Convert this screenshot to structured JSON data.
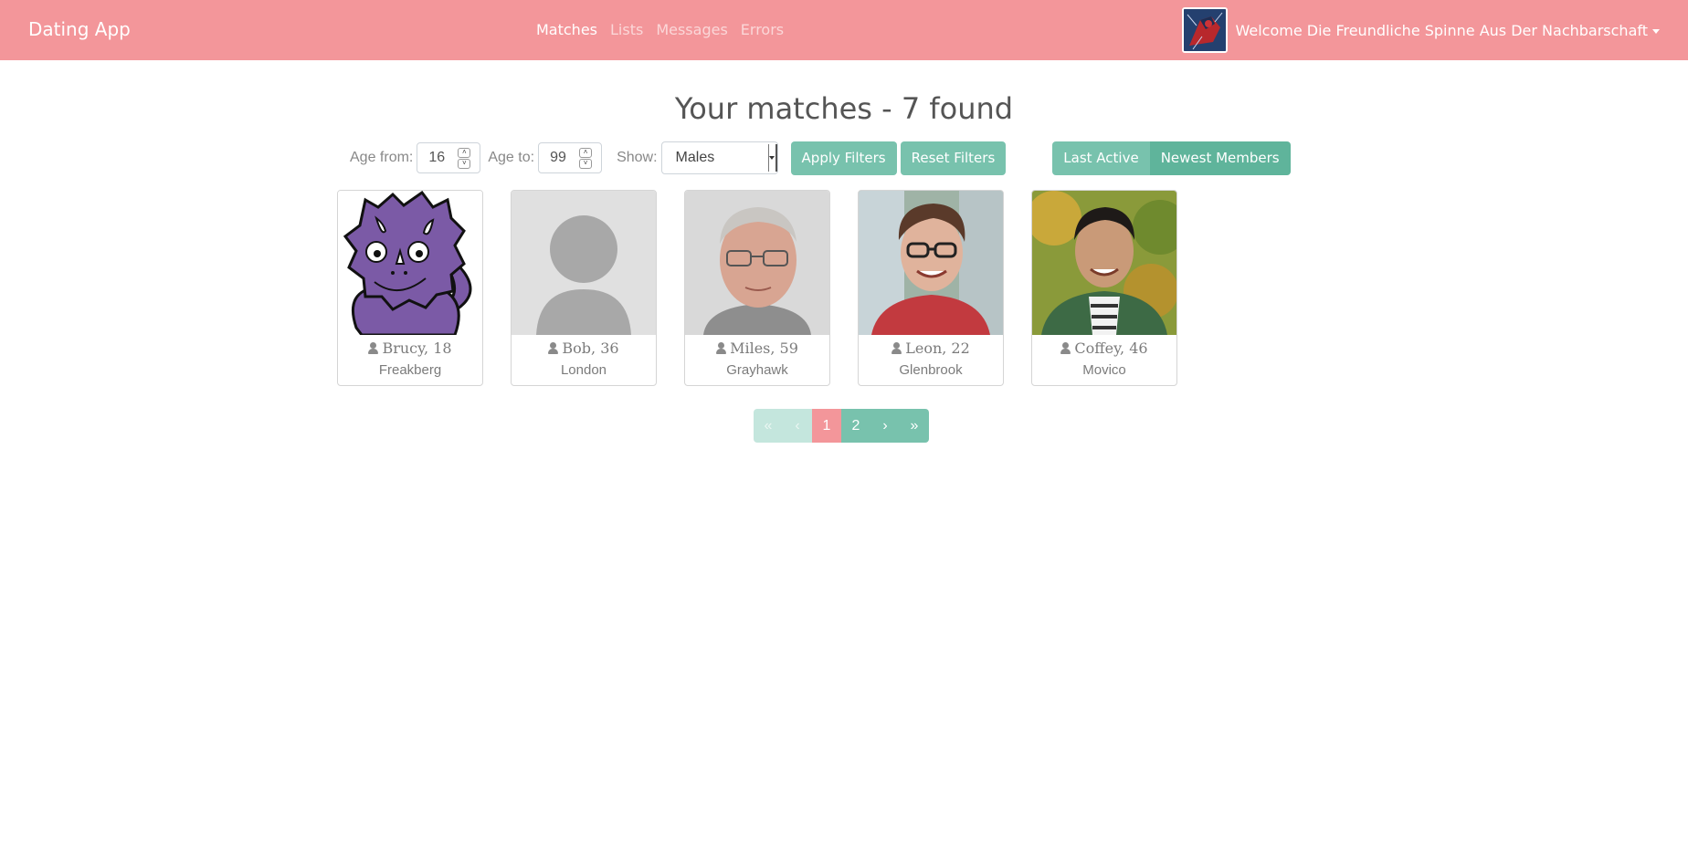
{
  "navbar": {
    "brand": "Dating App",
    "links": [
      {
        "label": "Matches",
        "active": true
      },
      {
        "label": "Lists",
        "active": false
      },
      {
        "label": "Messages",
        "active": false
      },
      {
        "label": "Errors",
        "active": false
      }
    ],
    "welcome": "Welcome Die Freundliche Spinne Aus Der Nachbarschaft",
    "avatar_icon": "user-avatar-icon"
  },
  "main": {
    "title": "Your matches - 7 found"
  },
  "filters": {
    "age_from_label": "Age from:",
    "age_from_value": "16",
    "age_to_label": "Age to:",
    "age_to_value": "99",
    "show_label": "Show:",
    "show_selected": "Males",
    "apply_label": "Apply Filters",
    "reset_label": "Reset Filters",
    "last_active_label": "Last Active",
    "newest_members_label": "Newest Members"
  },
  "members": [
    {
      "name": "Brucy, 18",
      "city": "Freakberg",
      "photo": "purple-dinosaur-cartoon"
    },
    {
      "name": "Bob, 36",
      "city": "London",
      "photo": "default-user-placeholder"
    },
    {
      "name": "Miles, 59",
      "city": "Grayhawk",
      "photo": "older-man-glasses-photo"
    },
    {
      "name": "Leon, 22",
      "city": "Glenbrook",
      "photo": "young-man-red-shirt-photo"
    },
    {
      "name": "Coffey, 46",
      "city": "Movico",
      "photo": "man-green-jacket-photo"
    }
  ],
  "pagination": {
    "first": "«",
    "prev": "‹",
    "pages": [
      "1",
      "2"
    ],
    "current": "1",
    "next": "›",
    "last": "»"
  },
  "colors": {
    "primary": "#78c2ad",
    "secondary": "#f3969a",
    "text": "#888888"
  }
}
